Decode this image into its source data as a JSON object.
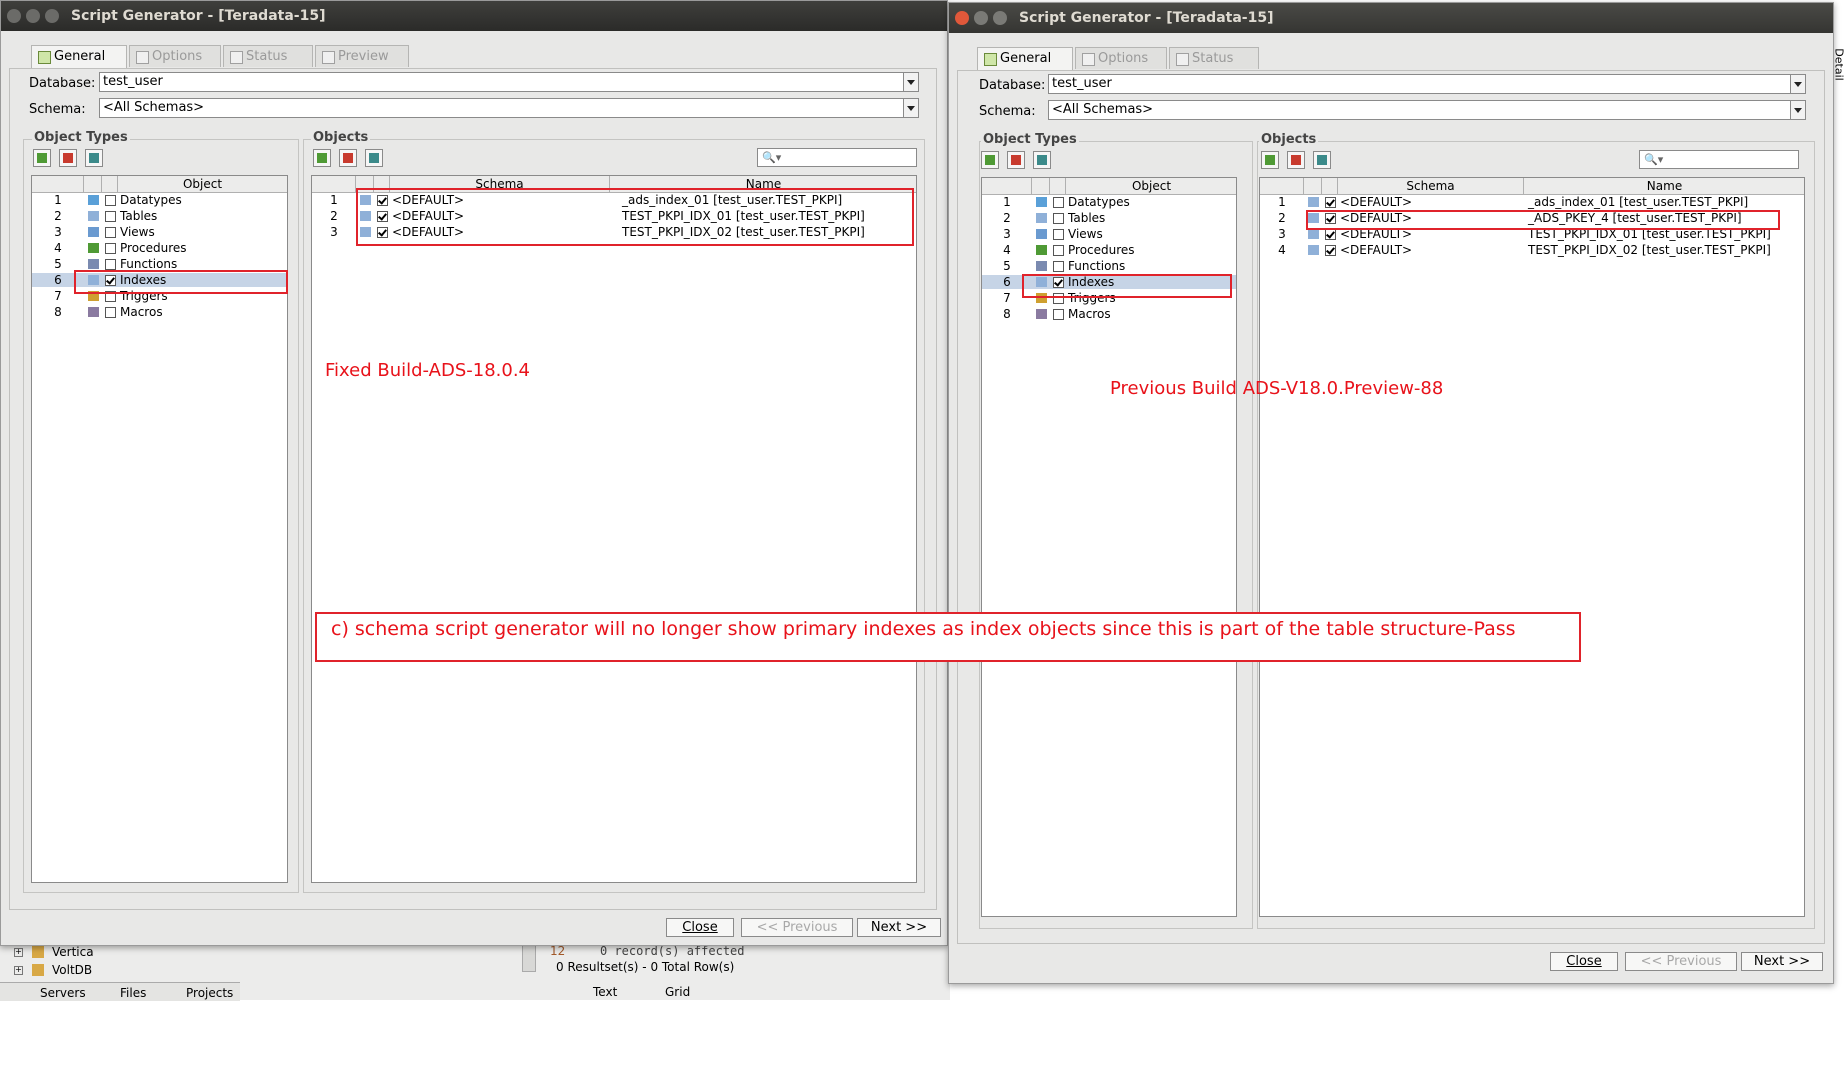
{
  "left_window": {
    "title": "Script Generator - [Teradata-15]",
    "tabs": [
      "General",
      "Options",
      "Status",
      "Preview"
    ],
    "database_label": "Database:",
    "database_value": "test_user",
    "schema_label": "Schema:",
    "schema_value": "<All Schemas>",
    "object_types_title": "Object Types",
    "object_header": "Object",
    "object_types": [
      {
        "n": "1",
        "label": "Datatypes",
        "checked": false
      },
      {
        "n": "2",
        "label": "Tables",
        "checked": false
      },
      {
        "n": "3",
        "label": "Views",
        "checked": false
      },
      {
        "n": "4",
        "label": "Procedures",
        "checked": false
      },
      {
        "n": "5",
        "label": "Functions",
        "checked": false
      },
      {
        "n": "6",
        "label": "Indexes",
        "checked": true
      },
      {
        "n": "7",
        "label": "Triggers",
        "checked": false
      },
      {
        "n": "8",
        "label": "Macros",
        "checked": false
      }
    ],
    "objects_title": "Objects",
    "schema_header": "Schema",
    "name_header": "Name",
    "objects": [
      {
        "n": "1",
        "schema": "<DEFAULT>",
        "name": "_ads_index_01 [test_user.TEST_PKPI]"
      },
      {
        "n": "2",
        "schema": "<DEFAULT>",
        "name": "TEST_PKPI_IDX_01 [test_user.TEST_PKPI]"
      },
      {
        "n": "3",
        "schema": "<DEFAULT>",
        "name": "TEST_PKPI_IDX_02 [test_user.TEST_PKPI]"
      }
    ],
    "buttons": {
      "close": "Close",
      "previous": "<< Previous",
      "next": "Next >>"
    }
  },
  "right_window": {
    "title": "Script Generator - [Teradata-15]",
    "tabs": [
      "General",
      "Options",
      "Status"
    ],
    "database_label": "Database:",
    "database_value": "test_user",
    "schema_label": "Schema:",
    "schema_value": "<All Schemas>",
    "object_types_title": "Object Types",
    "object_header": "Object",
    "object_types": [
      {
        "n": "1",
        "label": "Datatypes",
        "checked": false
      },
      {
        "n": "2",
        "label": "Tables",
        "checked": false
      },
      {
        "n": "3",
        "label": "Views",
        "checked": false
      },
      {
        "n": "4",
        "label": "Procedures",
        "checked": false
      },
      {
        "n": "5",
        "label": "Functions",
        "checked": false
      },
      {
        "n": "6",
        "label": "Indexes",
        "checked": true
      },
      {
        "n": "7",
        "label": "Triggers",
        "checked": false
      },
      {
        "n": "8",
        "label": "Macros",
        "checked": false
      }
    ],
    "objects_title": "Objects",
    "schema_header": "Schema",
    "name_header": "Name",
    "objects": [
      {
        "n": "1",
        "schema": "<DEFAULT>",
        "name": "_ads_index_01 [test_user.TEST_PKPI]"
      },
      {
        "n": "2",
        "schema": "<DEFAULT>",
        "name": "_ADS_PKEY_4 [test_user.TEST_PKPI]"
      },
      {
        "n": "3",
        "schema": "<DEFAULT>",
        "name": "TEST_PKPI_IDX_01 [test_user.TEST_PKPI]"
      },
      {
        "n": "4",
        "schema": "<DEFAULT>",
        "name": "TEST_PKPI_IDX_02 [test_user.TEST_PKPI]"
      }
    ],
    "buttons": {
      "close": "Close",
      "previous": "<< Previous",
      "next": "Next >>"
    }
  },
  "annotations": {
    "fixed_build": "Fixed Build-ADS-18.0.4",
    "previous_build": "Previous Build ADS-V18.0.Preview-88",
    "note": "c) schema script generator will no longer show primary indexes as index objects since this is part of the table structure-Pass"
  },
  "background": {
    "tree_items": [
      "Vertica",
      "VoltDB"
    ],
    "bottom_tabs": [
      "Servers",
      "Files",
      "Projects"
    ],
    "result_line_num": "12",
    "result_line1": "0 record(s) affected",
    "result_line2": "0 Resultset(s) - 0 Total Row(s)",
    "output_tabs": [
      "Text",
      "Grid"
    ],
    "side_label": "Detail"
  },
  "colors": {
    "annotation_red": "#e8121a",
    "selection": "#c6d4e6",
    "titlebar": "#2f2f2d"
  }
}
